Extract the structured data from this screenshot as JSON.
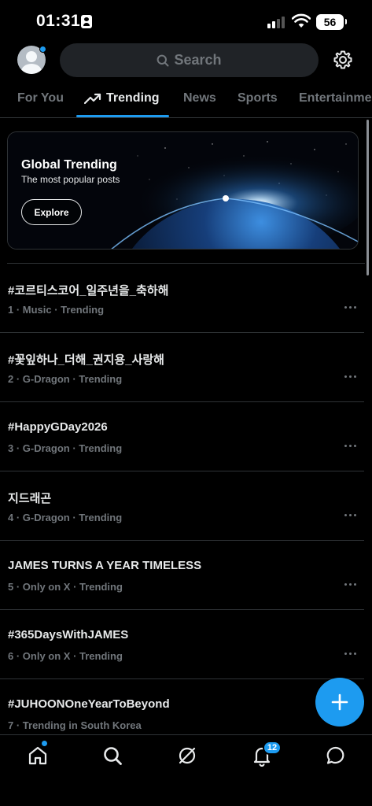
{
  "status_bar": {
    "time": "01:31",
    "battery": "56"
  },
  "header": {
    "search_placeholder": "Search"
  },
  "tabs": [
    {
      "label": "For You"
    },
    {
      "label": "Trending"
    },
    {
      "label": "News"
    },
    {
      "label": "Sports"
    },
    {
      "label": "Entertainme"
    }
  ],
  "banner": {
    "title": "Global Trending",
    "subtitle": "The most popular posts",
    "button_label": "Explore"
  },
  "trends": [
    {
      "title": "#코르티스코어_일주년을_축하해",
      "meta": "1 · Music · Trending"
    },
    {
      "title": "#꽃잎하나_더해_권지용_사랑해",
      "meta": "2 · G-Dragon · Trending"
    },
    {
      "title": "#HappyGDay2026",
      "meta": "3 · G-Dragon · Trending"
    },
    {
      "title": "지드래곤",
      "meta": "4 · G-Dragon · Trending"
    },
    {
      "title": "JAMES TURNS A YEAR TIMELESS",
      "meta": "5 · Only on X · Trending"
    },
    {
      "title": "#365DaysWithJAMES",
      "meta": "6 · Only on X · Trending"
    },
    {
      "title": "#JUHOONOneYearToBeyond",
      "meta": "7 · Trending in South Korea"
    }
  ],
  "bottom_nav": {
    "notifications_count": "12",
    "items": [
      "home-icon",
      "search-icon",
      "grok-icon",
      "bell-icon",
      "messages-icon"
    ]
  },
  "colors": {
    "accent": "#1d9bf0",
    "background": "#000000",
    "secondary_text": "#71767b",
    "divider": "#2f3336"
  }
}
